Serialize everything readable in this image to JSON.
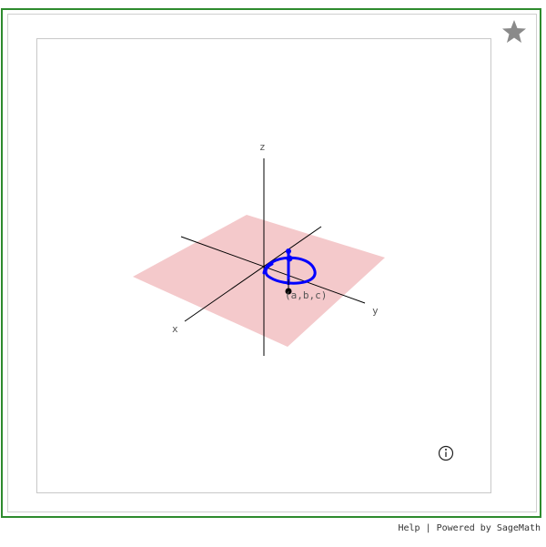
{
  "scene": {
    "axes": {
      "x": "x",
      "y": "y",
      "z": "z"
    },
    "point_label": "(a,b,c)",
    "colors": {
      "plane": "#f4c9cb",
      "curve": "#0000ff",
      "point": "#000000",
      "axis": "#000000",
      "frame": "#2e8b2e"
    }
  },
  "footer": {
    "help": "Help",
    "separator": " | ",
    "powered": "Powered by SageMath"
  },
  "icons": {
    "star": "star-icon",
    "info": "info-icon"
  }
}
